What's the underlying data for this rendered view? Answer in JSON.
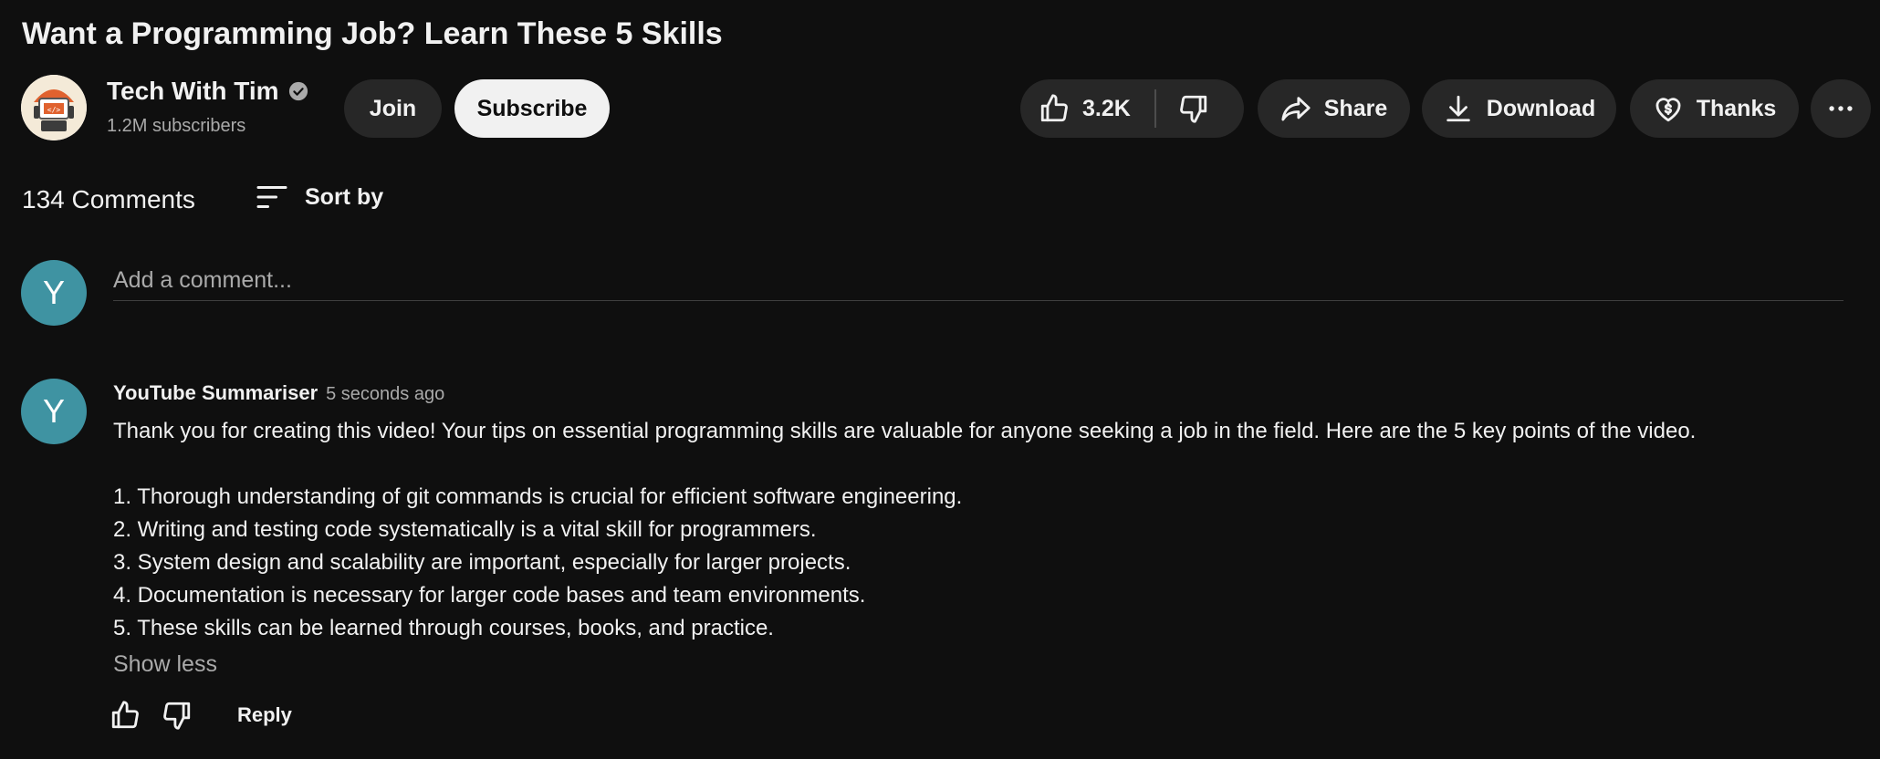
{
  "video": {
    "title": "Want a Programming Job? Learn These 5 Skills"
  },
  "channel": {
    "name": "Tech With Tim",
    "subscribers": "1.2M subscribers",
    "join_label": "Join",
    "subscribe_label": "Subscribe"
  },
  "actions": {
    "like_count": "3.2K",
    "share_label": "Share",
    "download_label": "Download",
    "thanks_label": "Thanks"
  },
  "comments": {
    "count_label": "134 Comments",
    "sort_label": "Sort by",
    "input_placeholder": "Add a comment...",
    "current_user_initial": "Y",
    "items": [
      {
        "avatar_initial": "Y",
        "author": "YouTube Summariser",
        "time": "5 seconds ago",
        "intro": "Thank you for creating this video! Your tips on essential programming skills are valuable for anyone seeking a job in the field. Here are the 5 key points of the video.",
        "points": [
          "1. Thorough understanding of git commands is crucial for efficient software engineering.",
          "2. Writing and testing code systematically is a vital skill for programmers.",
          "3. System design and scalability are important, especially for larger projects.",
          "4. Documentation is necessary for larger code bases and team environments.",
          "5. These skills can be learned through courses, books, and practice."
        ],
        "show_less_label": "Show less",
        "reply_label": "Reply"
      }
    ]
  },
  "colors": {
    "background": "#0f0f0f",
    "pill": "#272727",
    "avatar": "#3f93a2",
    "secondary_text": "#aaaaaa"
  }
}
